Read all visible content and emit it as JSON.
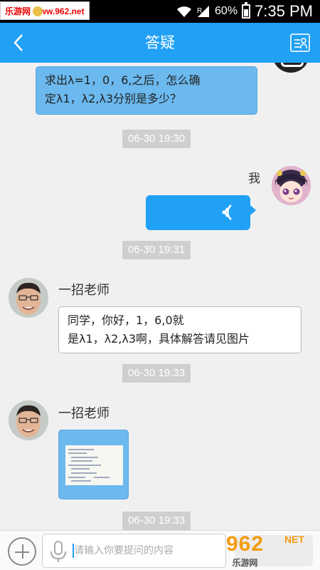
{
  "status_bar": {
    "watermark": "乐游网 www.962.net",
    "battery_pct": "60%",
    "time": "7:35 PM"
  },
  "nav": {
    "title": "答疑"
  },
  "messages": {
    "m1_line1": "求出λ=1，0，6,之后，怎么确",
    "m1_line2": "定λ1，λ2,λ3分别是多少？",
    "ts1": "06-30 19:30",
    "me_label": "我",
    "ts2": "06-30 19:31",
    "teacher_name": "一招老师",
    "m3_line1": "同学，你好，1，6,0就",
    "m3_line2": "是λ1，λ2,λ3啊，具体解答请见图片",
    "ts3": "06-30 19:33",
    "teacher_name_2": "一招老师",
    "ts4": "06-30 19:33"
  },
  "input": {
    "placeholder": "请输入你要提问的内容"
  },
  "footer_watermark": {
    "big": "962",
    "net": "NET",
    "sub": "乐游网"
  },
  "colors": {
    "accent": "#21a1f5",
    "student_bubble": "#6bb9ef",
    "timestamp_bg": "#cfcfcf",
    "background": "#f0f0f0"
  }
}
